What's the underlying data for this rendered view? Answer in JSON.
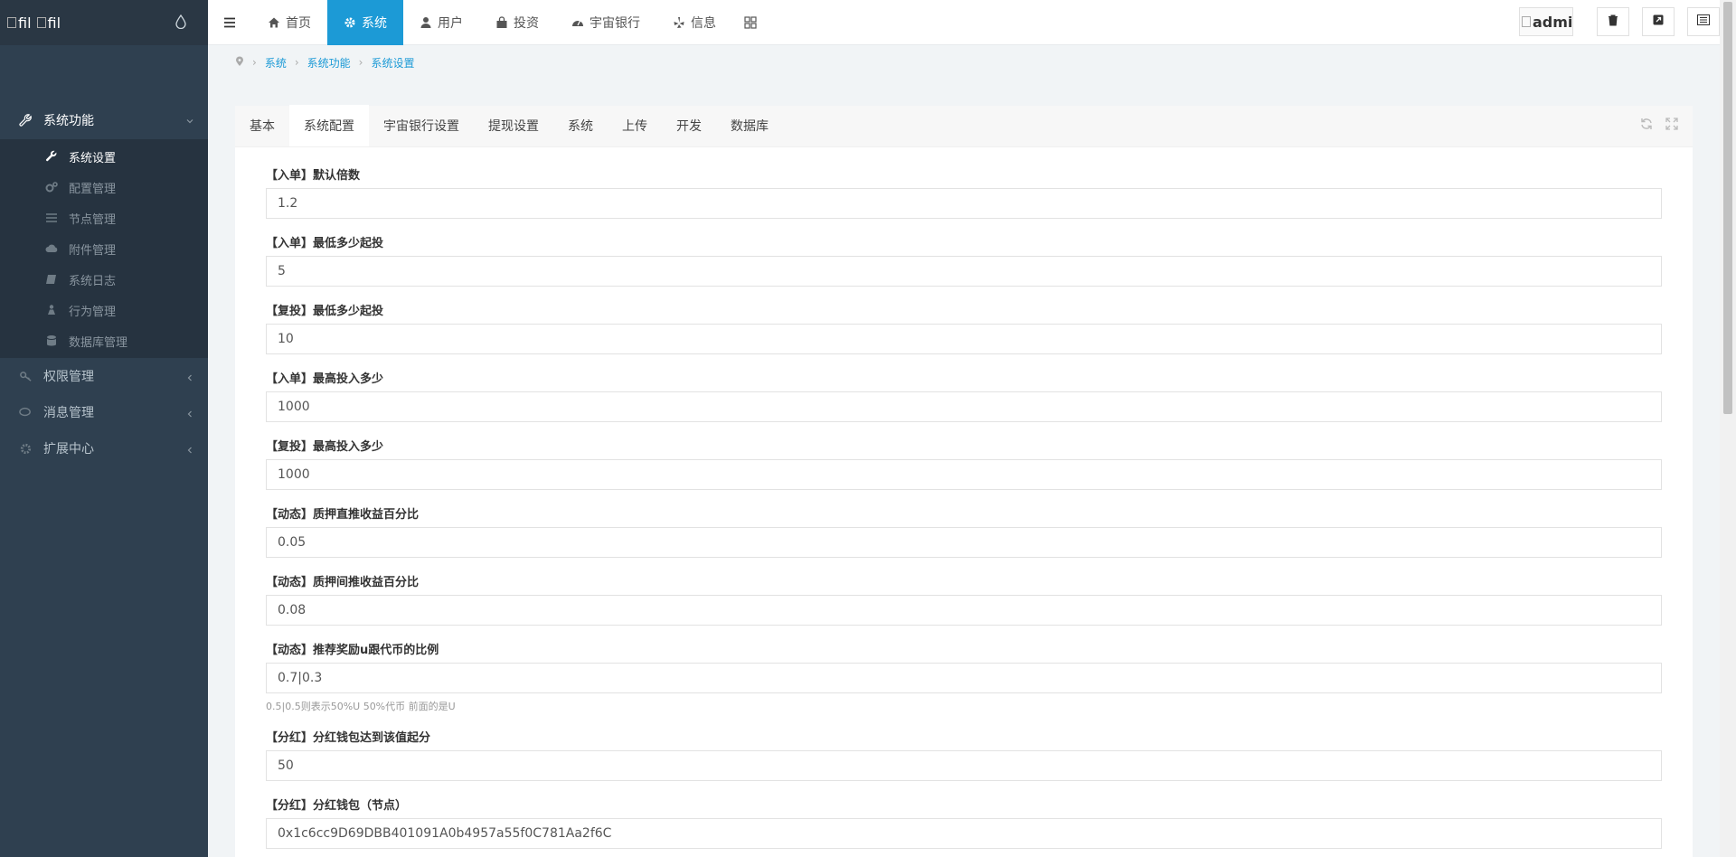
{
  "sidebar": {
    "logo_text_1": "fil",
    "logo_text_2": "fil",
    "groups": [
      {
        "label": "系统功能",
        "icon": "wrench-icon"
      },
      {
        "label": "权限管理",
        "icon": "key-icon"
      },
      {
        "label": "消息管理",
        "icon": "comments-icon"
      },
      {
        "label": "扩展中心",
        "icon": "gears-icon"
      }
    ],
    "sub_items": [
      {
        "label": "系统设置",
        "icon": "wrench-icon"
      },
      {
        "label": "配置管理",
        "icon": "cogs-icon"
      },
      {
        "label": "节点管理",
        "icon": "list-icon"
      },
      {
        "label": "附件管理",
        "icon": "cloud-icon"
      },
      {
        "label": "系统日志",
        "icon": "book-icon"
      },
      {
        "label": "行为管理",
        "icon": "pawn-icon"
      },
      {
        "label": "数据库管理",
        "icon": "database-icon"
      }
    ]
  },
  "topnav": {
    "items": [
      {
        "label": "首页",
        "icon": "home-icon"
      },
      {
        "label": "系统",
        "icon": "gear-icon"
      },
      {
        "label": "用户",
        "icon": "user-icon"
      },
      {
        "label": "投资",
        "icon": "bag-icon"
      },
      {
        "label": "宇宙银行",
        "icon": "dashboard-icon"
      },
      {
        "label": "信息",
        "icon": "yelp-icon"
      }
    ],
    "avatar_alt": "admin"
  },
  "breadcrumb": [
    "系统",
    "系统功能",
    "系统设置"
  ],
  "tabs": [
    "基本",
    "系统配置",
    "宇宙银行设置",
    "提现设置",
    "系统",
    "上传",
    "开发",
    "数据库"
  ],
  "fields": [
    {
      "label": "【入单】默认倍数",
      "value": "1.2"
    },
    {
      "label": "【入单】最低多少起投",
      "value": "5"
    },
    {
      "label": "【复投】最低多少起投",
      "value": "10"
    },
    {
      "label": "【入单】最高投入多少",
      "value": "1000"
    },
    {
      "label": "【复投】最高投入多少",
      "value": "1000"
    },
    {
      "label": "【动态】质押直推收益百分比",
      "value": "0.05"
    },
    {
      "label": "【动态】质押间推收益百分比",
      "value": "0.08"
    },
    {
      "label": "【动态】推荐奖励u跟代币的比例",
      "value": "0.7|0.3",
      "help": "0.5|0.5则表示50%U 50%代币 前面的是U"
    },
    {
      "label": "【分红】分红钱包达到该值起分",
      "value": "50"
    },
    {
      "label": "【分红】分红钱包（节点）",
      "value": "0x1c6cc9D69DBB401091A0b4957a55f0C781Aa2f6C"
    }
  ],
  "colors": {
    "accent": "#1c9ad6",
    "sidebar": "#2f4050"
  }
}
